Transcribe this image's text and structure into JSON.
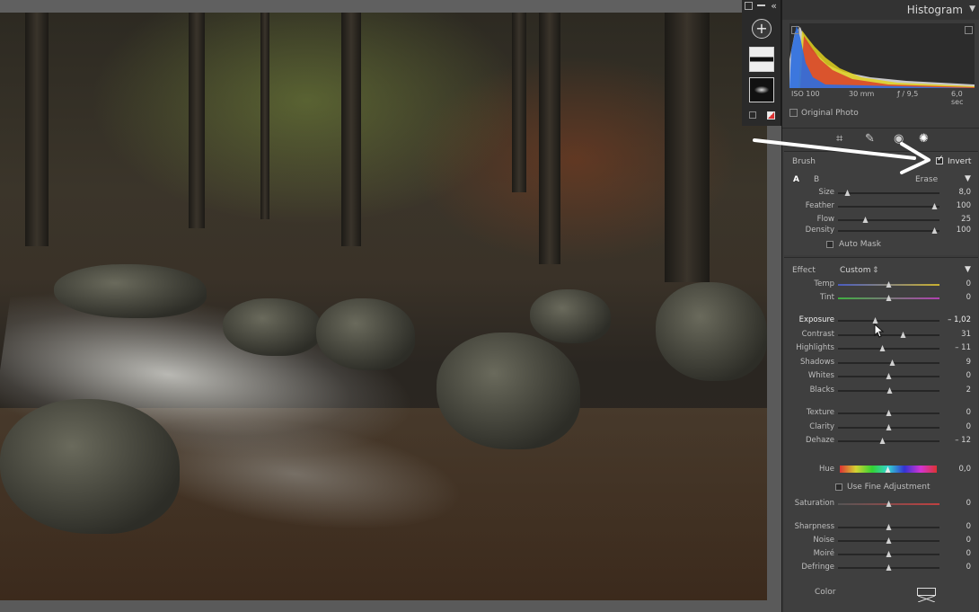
{
  "histogram": {
    "title": "Histogram",
    "iso": "ISO 100",
    "focal": "30 mm",
    "aperture": "ƒ / 9,5",
    "shutter": "6,0 sec",
    "original_photo_label": "Original Photo"
  },
  "brush": {
    "label": "Brush",
    "invert_label": "Invert",
    "invert_checked": true,
    "tab_a": "A",
    "tab_b": "B",
    "erase_label": "Erase",
    "auto_mask_label": "Auto Mask",
    "sliders": [
      {
        "name": "Size",
        "value": "8,0",
        "pos": 0.1
      },
      {
        "name": "Feather",
        "value": "100",
        "pos": 0.96
      },
      {
        "name": "Flow",
        "value": "25",
        "pos": 0.27
      },
      {
        "name": "Density",
        "value": "100",
        "pos": 0.96
      }
    ]
  },
  "effect": {
    "label": "Effect",
    "preset": "Custom",
    "color_label": "Color",
    "hue_label": "Hue",
    "hue_value": "0,0",
    "fine_adjust_label": "Use Fine Adjustment",
    "groups": [
      [
        {
          "name": "Temp",
          "value": "0",
          "pos": 0.5,
          "track": "temp"
        },
        {
          "name": "Tint",
          "value": "0",
          "pos": 0.5,
          "track": "tint"
        }
      ],
      [
        {
          "name": "Exposure",
          "value": "– 1,02",
          "pos": 0.37,
          "highlight": true
        },
        {
          "name": "Contrast",
          "value": "31",
          "pos": 0.65
        },
        {
          "name": "Highlights",
          "value": "– 11",
          "pos": 0.44
        },
        {
          "name": "Shadows",
          "value": "9",
          "pos": 0.54
        },
        {
          "name": "Whites",
          "value": "0",
          "pos": 0.5
        },
        {
          "name": "Blacks",
          "value": "2",
          "pos": 0.51
        }
      ],
      [
        {
          "name": "Texture",
          "value": "0",
          "pos": 0.5
        },
        {
          "name": "Clarity",
          "value": "0",
          "pos": 0.5
        },
        {
          "name": "Dehaze",
          "value": "– 12",
          "pos": 0.44
        }
      ],
      [
        {
          "name": "Saturation",
          "value": "0",
          "pos": 0.5,
          "track": "sat"
        }
      ],
      [
        {
          "name": "Sharpness",
          "value": "0",
          "pos": 0.5
        },
        {
          "name": "Noise",
          "value": "0",
          "pos": 0.5
        },
        {
          "name": "Moiré",
          "value": "0",
          "pos": 0.5
        },
        {
          "name": "Defringe",
          "value": "0",
          "pos": 0.5
        }
      ]
    ]
  },
  "colors": {
    "panel_bg": "#3b3b3b",
    "section_bg": "#3f3f3f",
    "text": "#bdbdbd",
    "accent": "#ffffff"
  }
}
